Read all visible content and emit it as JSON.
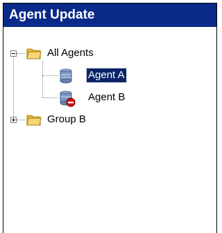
{
  "panel": {
    "title": "Agent Update"
  },
  "tree": {
    "nodes": [
      {
        "label": "All Agents",
        "icon": "folder-icon",
        "expanded": true
      },
      {
        "label": "Agent A",
        "icon": "server-icon",
        "selected": true
      },
      {
        "label": "Agent B",
        "icon": "server-error-icon"
      },
      {
        "label": "Group B",
        "icon": "folder-icon",
        "expanded": false
      }
    ]
  },
  "colors": {
    "title_bar": "#0a2a8a",
    "selection": "#0a246a"
  }
}
